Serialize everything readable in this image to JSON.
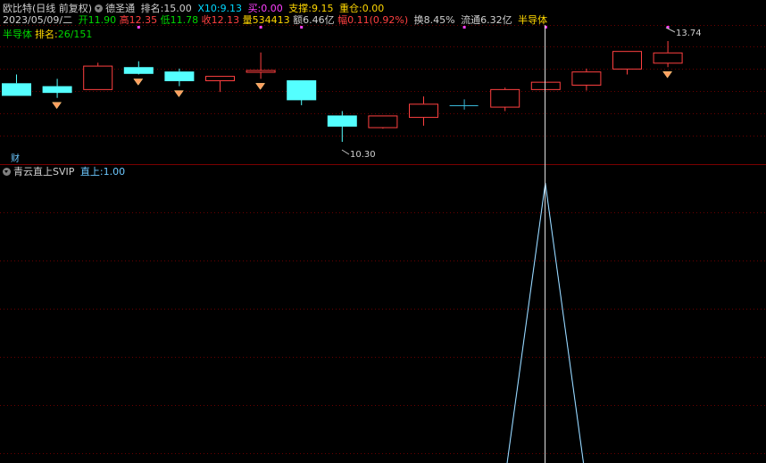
{
  "header": {
    "stock_title": "欧比特(日线 前复权)",
    "indicator_name": "德圣通",
    "rank_label": "排名:",
    "rank_value": "15.00",
    "x10_label": "X10:",
    "x10_value": "9.13",
    "buy_label": "买:",
    "buy_value": "0.00",
    "support_label": "支撑:",
    "support_value": "9.15",
    "heavy_label": "重仓:",
    "heavy_value": "0.00"
  },
  "quote": {
    "date": "2023/05/09/二",
    "open_label": "开",
    "open": "11.90",
    "high_label": "高",
    "high": "12.35",
    "low_label": "低",
    "low": "11.78",
    "close_label": "收",
    "close": "12.13",
    "volume_label": "量",
    "volume": "534413",
    "amount_label": "额",
    "amount": "6.46亿",
    "change_label": "幅",
    "change": "0.11(0.92%)",
    "turnover_label": "换",
    "turnover": "8.45%",
    "float_label": "流通",
    "float_cap": "6.32亿",
    "sector": "半导体"
  },
  "sector_line": {
    "sector": "半导体",
    "rank_label": "排名:",
    "rank_value": "26/151"
  },
  "annotations": {
    "high_price": "13.74",
    "low_price": "10.30",
    "cai_label": "财"
  },
  "sub_panel": {
    "indicator": "青云直上SVIP",
    "value_label": "直上:",
    "value": "1.00"
  },
  "colors": {
    "up": "#ff4040",
    "down": "#54ffff",
    "cross": "#3ab8d8",
    "signal": "#ffa060",
    "line": "#4aa6e0",
    "dot": "#ff40ff"
  },
  "chart_data": {
    "type": "candlestick",
    "ylim": [
      10.0,
      14.0
    ],
    "candles": [
      {
        "open": 12.3,
        "high": 12.6,
        "low": 11.9,
        "close": 11.9
      },
      {
        "open": 12.2,
        "high": 12.45,
        "low": 11.8,
        "close": 12.0
      },
      {
        "open": 12.1,
        "high": 13.0,
        "low": 12.1,
        "close": 12.9
      },
      {
        "open": 12.85,
        "high": 13.05,
        "low": 12.6,
        "close": 12.65
      },
      {
        "open": 12.7,
        "high": 12.8,
        "low": 12.2,
        "close": 12.4
      },
      {
        "open": 12.4,
        "high": 12.55,
        "low": 12.0,
        "close": 12.55
      },
      {
        "open": 12.7,
        "high": 13.35,
        "low": 12.45,
        "close": 12.75
      },
      {
        "open": 12.4,
        "high": 12.4,
        "low": 11.55,
        "close": 11.75
      },
      {
        "open": 11.2,
        "high": 11.35,
        "low": 10.3,
        "close": 10.85
      },
      {
        "open": 10.8,
        "high": 11.2,
        "low": 10.75,
        "close": 11.2
      },
      {
        "open": 11.15,
        "high": 11.85,
        "low": 10.85,
        "close": 11.6
      },
      {
        "open": 11.55,
        "high": 11.75,
        "low": 11.4,
        "close": 11.55
      },
      {
        "open": 11.5,
        "high": 12.15,
        "low": 11.35,
        "close": 12.1
      },
      {
        "open": 12.1,
        "high": 12.35,
        "low": 12.1,
        "close": 12.35
      },
      {
        "open": 12.25,
        "high": 12.8,
        "low": 12.05,
        "close": 12.7
      },
      {
        "open": 12.8,
        "high": 13.4,
        "low": 12.6,
        "close": 13.4
      },
      {
        "open": 13.0,
        "high": 13.74,
        "low": 12.85,
        "close": 13.35
      }
    ],
    "signal_markers": [
      1,
      3,
      4,
      6,
      16
    ],
    "top_dots": [
      3,
      6,
      7,
      11,
      13,
      16
    ],
    "selected_index": 13,
    "sub_line": {
      "values": [
        0,
        0,
        0,
        0,
        0,
        0,
        0,
        0,
        0,
        0,
        0,
        0,
        0,
        1,
        0,
        0,
        0
      ]
    }
  }
}
